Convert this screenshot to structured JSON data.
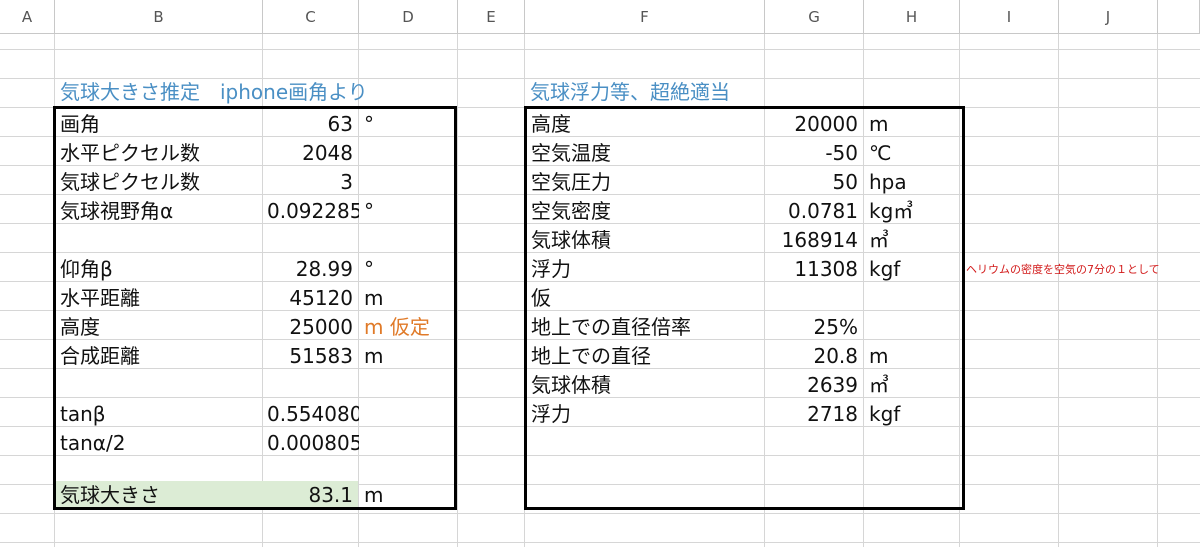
{
  "columns": [
    "A",
    "B",
    "C",
    "D",
    "E",
    "F",
    "G",
    "H",
    "I",
    "J"
  ],
  "left": {
    "title": "気球大きさ推定　iphone画角より",
    "rows": [
      {
        "label": "画角",
        "value": "63",
        "unit": "°"
      },
      {
        "label": "水平ピクセル数",
        "value": "2048",
        "unit": ""
      },
      {
        "label": "気球ピクセル数",
        "value": "3",
        "unit": ""
      },
      {
        "label": "気球視野角α",
        "value": "0.092285",
        "unit": "°"
      },
      {
        "label": "",
        "value": "",
        "unit": ""
      },
      {
        "label": "仰角β",
        "value": "28.99",
        "unit": "°"
      },
      {
        "label": "水平距離",
        "value": "45120",
        "unit": "m"
      },
      {
        "label": "高度",
        "value": "25000",
        "unit": "m 仮定"
      },
      {
        "label": "合成距離",
        "value": "51583",
        "unit": "m"
      },
      {
        "label": "",
        "value": "",
        "unit": ""
      },
      {
        "label": "tanβ",
        "value": "0.554080",
        "unit": ""
      },
      {
        "label": "tanα/2",
        "value": "0.000805",
        "unit": ""
      },
      {
        "label": "",
        "value": "",
        "unit": ""
      },
      {
        "label": "気球大きさ",
        "value": "83.1",
        "unit": "m"
      }
    ]
  },
  "right": {
    "title": "気球浮力等、超絶適当",
    "rows": [
      {
        "label": "高度",
        "value": "20000",
        "unit": "m"
      },
      {
        "label": "空気温度",
        "value": "-50",
        "unit": "℃"
      },
      {
        "label": "空気圧力",
        "value": "50",
        "unit": "hpa"
      },
      {
        "label": "空気密度",
        "value": "0.0781",
        "unit": "kg㎥"
      },
      {
        "label": "気球体積",
        "value": "168914",
        "unit": "㎥"
      },
      {
        "label": "浮力",
        "value": "11308",
        "unit": "kgf"
      },
      {
        "label": "仮",
        "value": "",
        "unit": ""
      },
      {
        "label": "地上での直径倍率",
        "value": "25%",
        "unit": ""
      },
      {
        "label": "地上での直径",
        "value": "20.8",
        "unit": "m"
      },
      {
        "label": "気球体積",
        "value": "2639",
        "unit": "㎥"
      },
      {
        "label": "浮力",
        "value": "2718",
        "unit": "kgf"
      }
    ],
    "note": "ヘリウムの密度を空気の7分の１として"
  },
  "colors": {
    "title": "#4a8fc4",
    "orange": "#e07a28",
    "note": "#d21a1a",
    "highlight": "#dcecd5"
  }
}
